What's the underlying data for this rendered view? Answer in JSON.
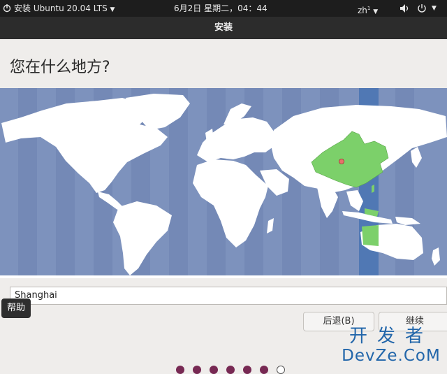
{
  "topbar": {
    "app_label": "安装 Ubuntu 20.04 LTS",
    "clock": "6月2日 星期二，04：44",
    "input_method": "zh"
  },
  "window": {
    "title": "安装"
  },
  "page": {
    "heading": "您在什么地方?"
  },
  "timezone": {
    "value": "Shanghai"
  },
  "tooltip": {
    "text": "帮助"
  },
  "buttons": {
    "back": "后退(B)",
    "continue": "继续"
  },
  "watermark": {
    "line1": "开发者",
    "line2": "DevZe.CoM"
  },
  "progress": {
    "total_steps": 7,
    "completed_steps": 6
  },
  "colors": {
    "ocean": "#7d92bd",
    "land": "#ffffff",
    "selected_region": "#7cd06a",
    "selected_zone": "#5078b4",
    "dot_done": "#772953"
  }
}
